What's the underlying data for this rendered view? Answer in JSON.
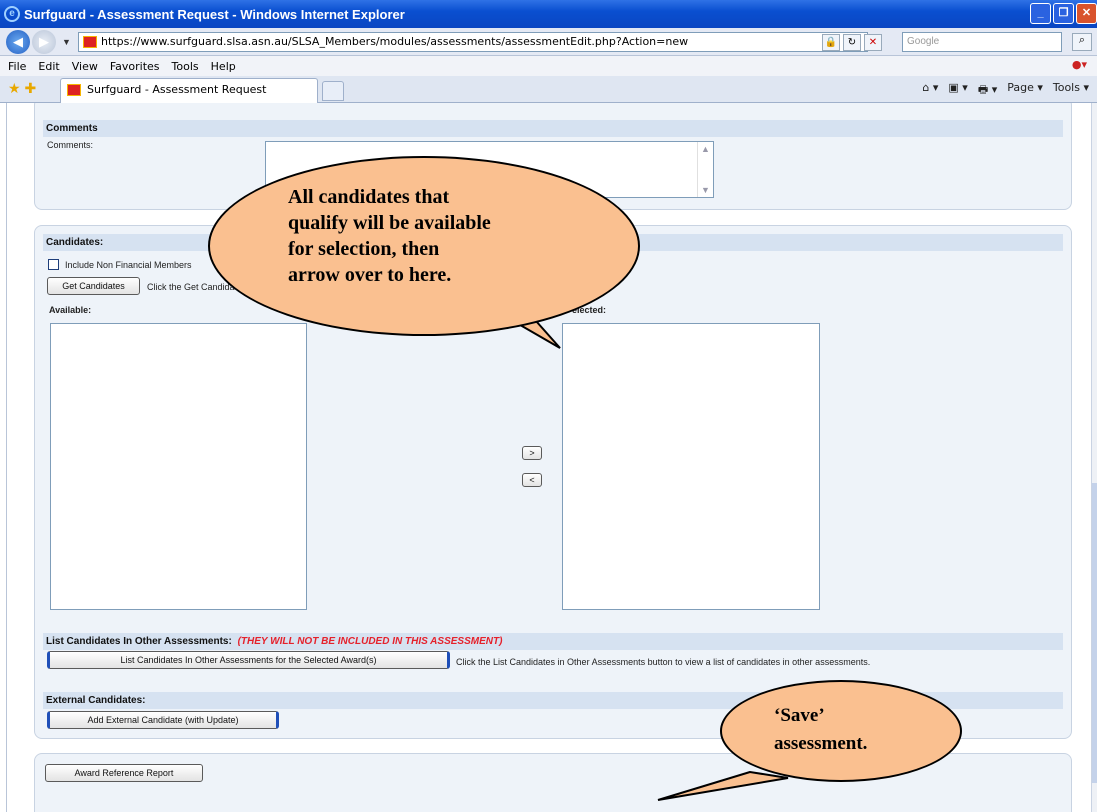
{
  "window": {
    "title": "Surfguard - Assessment Request - Windows Internet Explorer",
    "controls": [
      "_",
      "❐",
      "✕"
    ]
  },
  "address": {
    "url": "https://www.surfguard.slsa.asn.au/SLSA_Members/modules/assessments/assessmentEdit.php?Action=new",
    "search_placeholder": "Google"
  },
  "menu": [
    "File",
    "Edit",
    "View",
    "Favorites",
    "Tools",
    "Help"
  ],
  "tab": {
    "label": "Surfguard - Assessment Request"
  },
  "commands": {
    "page": "Page ▾",
    "tools": "Tools ▾"
  },
  "comments": {
    "header": "Comments",
    "label": "Comments:",
    "value": ""
  },
  "candidates": {
    "header": "Candidates:",
    "include_nonfinancial": "Include Non Financial Members",
    "get_button": "Get Candidates",
    "get_hint": "Click the Get Candidate",
    "available_label": "Available:",
    "selected_label": "elected:",
    "move_right": ">",
    "move_left": "<"
  },
  "other_assessments": {
    "header": "List Candidates In Other Assessments:",
    "warning": "(THEY WILL NOT BE INCLUDED IN THIS ASSESSMENT)",
    "button": "List Candidates In Other Assessments for the Selected Award(s)",
    "hint": "Click the List Candidates in Other Assessments button to view a list of candidates in other assessments."
  },
  "external": {
    "header": "External Candidates:",
    "button": "Add External Candidate (with Update)"
  },
  "report": {
    "button": "Award Reference Report"
  },
  "callouts": {
    "candidates": [
      "All candidates that",
      "qualify will be available",
      "for selection, then",
      "arrow over to here."
    ],
    "save": [
      "‘Save’",
      "assessment."
    ]
  },
  "colors": {
    "callout_fill": "#fac090",
    "warning_red": "#e5212b",
    "section_header": "#d6e2f1"
  }
}
